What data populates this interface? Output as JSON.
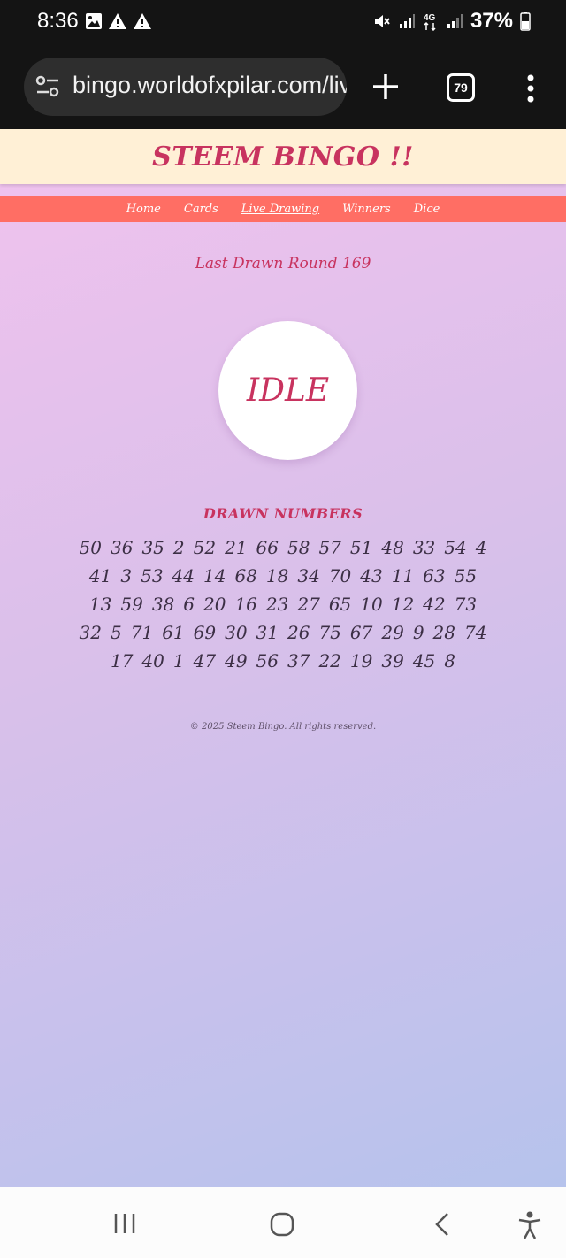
{
  "status_bar": {
    "time": "8:36",
    "battery": "37%",
    "left_icons": [
      "image-icon",
      "warning-icon",
      "warning-icon"
    ],
    "right_icons": [
      "mute-icon",
      "signal-icon",
      "4g-icon",
      "signal-icon",
      "battery-icon"
    ]
  },
  "browser": {
    "url": "bingo.worldofxpilar.com/live",
    "tab_count": "79"
  },
  "site": {
    "title": "STEEM BINGO !!",
    "nav": [
      "Home",
      "Cards",
      "Live Drawing",
      "Winners",
      "Dice"
    ],
    "active_nav": "Live Drawing",
    "last_round": "Last Drawn Round 169",
    "status": "IDLE",
    "drawn_title": "DRAWN NUMBERS",
    "drawn_numbers": [
      "50",
      "36",
      "35",
      "2",
      "52",
      "21",
      "66",
      "58",
      "57",
      "51",
      "48",
      "33",
      "54",
      "4",
      "41",
      "3",
      "53",
      "44",
      "14",
      "68",
      "18",
      "34",
      "70",
      "43",
      "11",
      "63",
      "55",
      "13",
      "59",
      "38",
      "6",
      "20",
      "16",
      "23",
      "27",
      "65",
      "10",
      "12",
      "42",
      "73",
      "32",
      "5",
      "71",
      "61",
      "69",
      "30",
      "31",
      "26",
      "75",
      "67",
      "29",
      "9",
      "28",
      "74",
      "17",
      "40",
      "1",
      "47",
      "49",
      "56",
      "37",
      "22",
      "19",
      "39",
      "45",
      "8"
    ],
    "footer": "© 2025 Steem Bingo. All rights reserved."
  },
  "colors": {
    "accent": "#c8335f",
    "nav_bg": "#ff6e64",
    "header_bg": "#fff0d6"
  }
}
